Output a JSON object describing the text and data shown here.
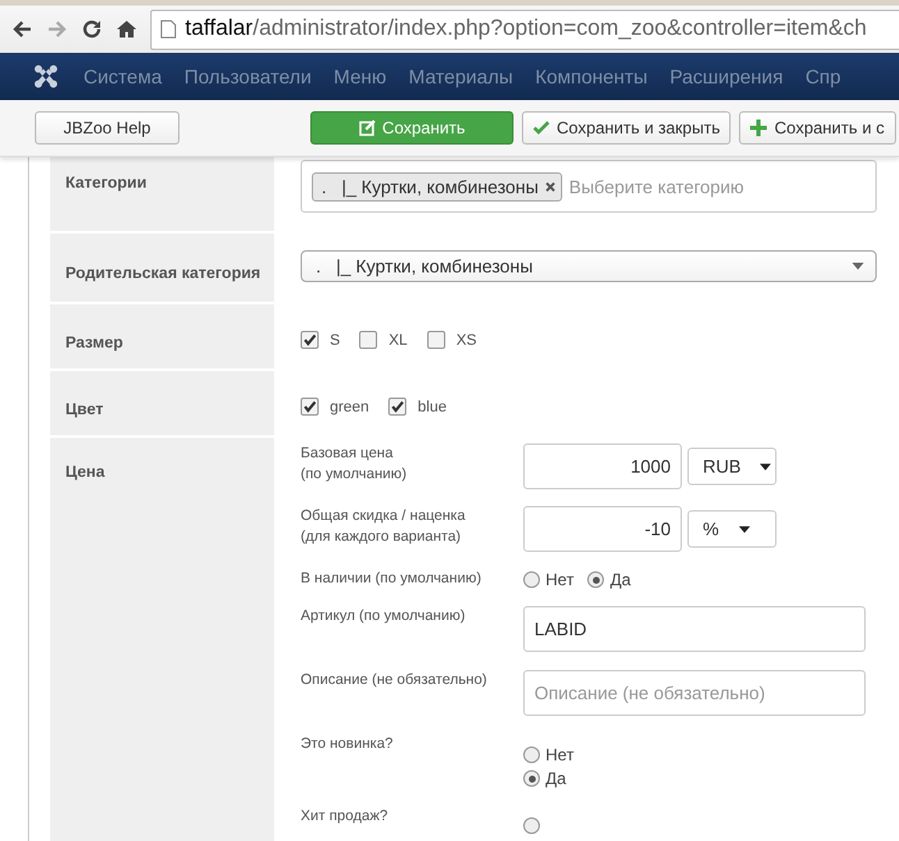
{
  "browser": {
    "url_host": "taffalar",
    "url_path": "/administrator/index.php?option=com_zoo&controller=item&ch"
  },
  "nav": {
    "items": [
      "Система",
      "Пользователи",
      "Меню",
      "Материалы",
      "Компоненты",
      "Расширения",
      "Спр"
    ]
  },
  "toolbar": {
    "buttons": [
      {
        "kind": "plain",
        "label": "JBZoo Help"
      },
      {
        "kind": "primary",
        "label": "Сохранить"
      },
      {
        "kind": "check",
        "label": "Сохранить и закрыть"
      },
      {
        "kind": "plus",
        "label": "Сохранить и с"
      }
    ]
  },
  "fields": [
    {
      "kind": "tags",
      "label": "Категории",
      "tags": [
        ".   |_ Куртки, комбинезоны"
      ],
      "placeholder": "Выберите категорию"
    },
    {
      "kind": "select",
      "label": "Родительская категория",
      "value": ".   |_ Куртки, комбинезоны"
    },
    {
      "kind": "checks",
      "label": "Размер",
      "options": [
        {
          "label": "S",
          "checked": true
        },
        {
          "label": "XL",
          "checked": false
        },
        {
          "label": "XS",
          "checked": false
        }
      ]
    },
    {
      "kind": "checks",
      "label": "Цвет",
      "options": [
        {
          "label": "green",
          "checked": true
        },
        {
          "label": "blue",
          "checked": true
        }
      ]
    },
    {
      "kind": "price",
      "label": "Цена",
      "items": [
        {
          "kind": "amount",
          "label": "Базовая цена\n(по умолчанию)",
          "value": "1000",
          "unit": "RUB"
        },
        {
          "kind": "amount",
          "label": "Общая скидка / наценка\n(для каждого варианта)",
          "value": "-10",
          "unit": "%"
        },
        {
          "kind": "radios",
          "label": "В наличии (по умолчанию)",
          "options": [
            {
              "label": "Нет",
              "selected": false
            },
            {
              "label": "Да",
              "selected": true
            }
          ]
        },
        {
          "kind": "text",
          "label": "Артикул (по умолчанию)",
          "value": "LABID"
        },
        {
          "kind": "text",
          "label": "Описание (не обязательно)",
          "placeholder": "Описание (не обязательно)"
        },
        {
          "kind": "stacked",
          "label": "Это новинка?",
          "options": [
            {
              "label": "Нет",
              "selected": false
            },
            {
              "label": "Да",
              "selected": true
            }
          ]
        },
        {
          "kind": "stacked",
          "label": "Хит продаж?",
          "options": [
            {
              "selected": false
            }
          ]
        }
      ]
    }
  ]
}
